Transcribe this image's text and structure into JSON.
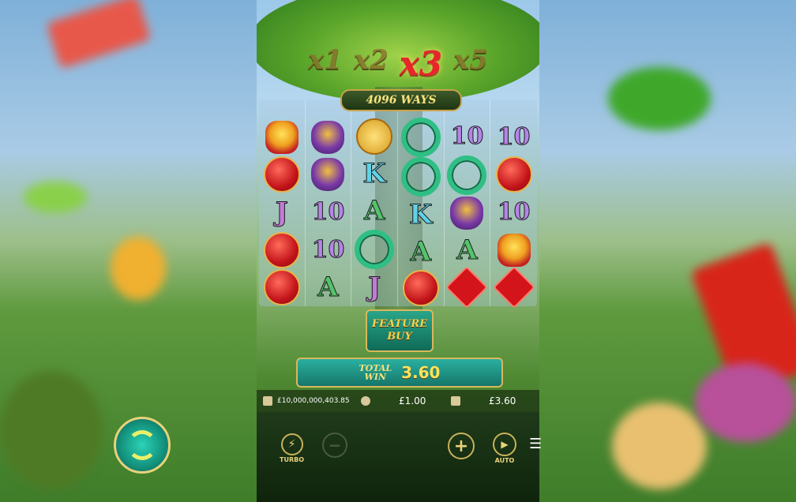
{
  "multipliers": [
    {
      "label": "x1",
      "active": false
    },
    {
      "label": "x2",
      "active": false
    },
    {
      "label": "x3",
      "active": true
    },
    {
      "label": "x5",
      "active": false
    }
  ],
  "ways_label": "4096 WAYS",
  "reels": [
    [
      "treasure-coins",
      "red-lantern",
      "J",
      "red-lantern",
      "red-lantern"
    ],
    [
      "bag",
      "bag",
      "10",
      "10",
      "A"
    ],
    [
      "gold-coin",
      "K",
      "A",
      "jade-pendant",
      "J"
    ],
    [
      "jade-pendant",
      "jade-pendant",
      "K",
      "A",
      "red-lantern"
    ],
    [
      "10",
      "jade-pendant",
      "bag",
      "A",
      "chinese-knot"
    ],
    [
      "10",
      "red-lantern",
      "10",
      "treasure-bowl",
      "chinese-knot"
    ]
  ],
  "feature_buy": {
    "line1": "FEATURE",
    "line2": "BUY"
  },
  "total_win": {
    "label_line1": "TOTAL",
    "label_line2": "WIN",
    "value": "3.60"
  },
  "info": {
    "balance": "£10,000,000,403.85",
    "bet": "£1.00",
    "win": "£3.60"
  },
  "controls": {
    "turbo_label": "TURBO",
    "auto_label": "AUTO"
  },
  "colors": {
    "accent": "#e8d27a",
    "win_value": "#ffe35a",
    "multiplier_active": "#e8252a"
  }
}
